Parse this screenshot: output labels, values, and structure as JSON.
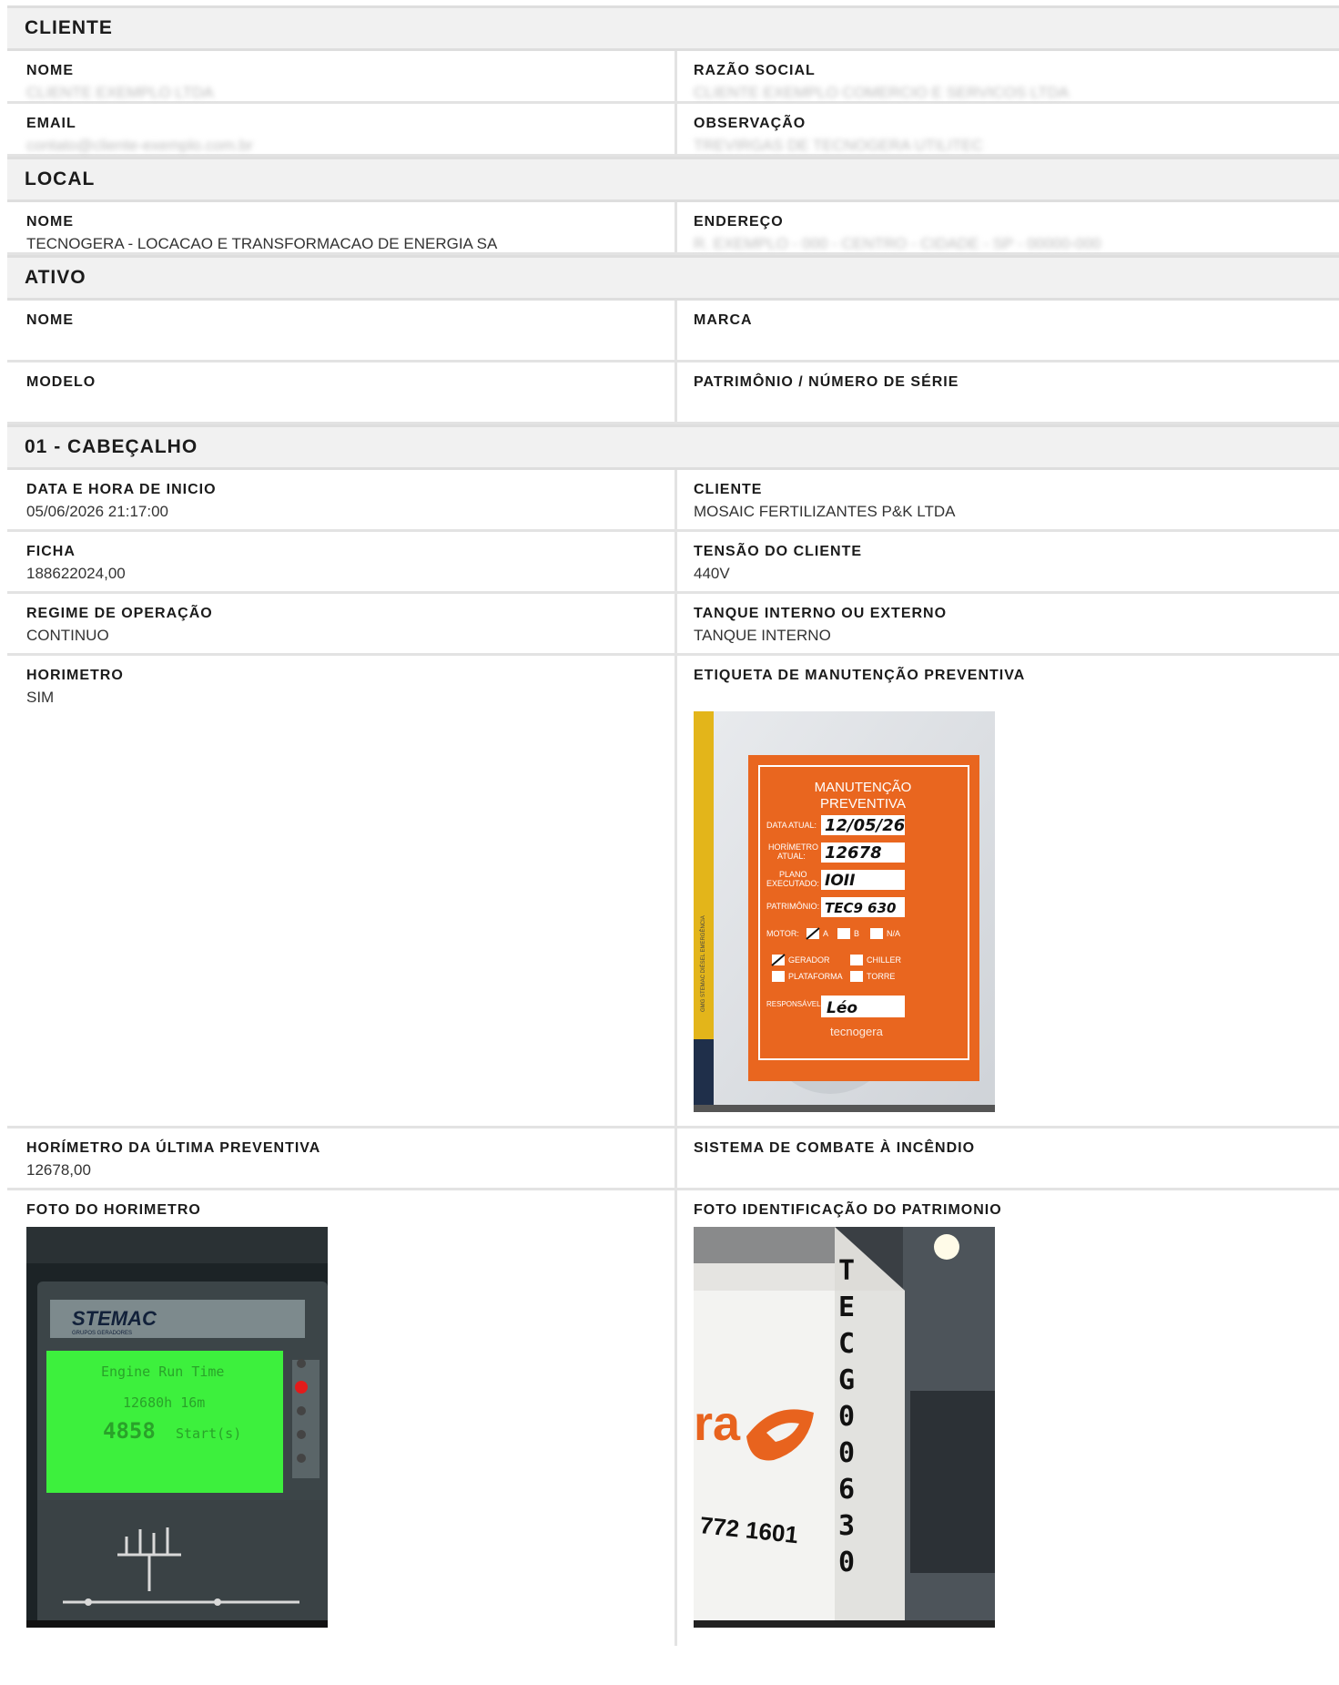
{
  "sections": {
    "cliente": {
      "title": "CLIENTE",
      "nome_label": "NOME",
      "nome_value": "CLIENTE EXEMPLO LTDA",
      "razao_label": "RAZÃO SOCIAL",
      "razao_value": "CLIENTE EXEMPLO COMERCIO E SERVICOS LTDA",
      "email_label": "EMAIL",
      "email_value": "contato@cliente-exemplo.com.br",
      "obs_label": "OBSERVAÇÃO",
      "obs_value": "TREVIRGAS DE TECNOGERA UTILITEC"
    },
    "local": {
      "title": "LOCAL",
      "nome_label": "NOME",
      "nome_value": "TECNOGERA - LOCACAO E TRANSFORMACAO DE ENERGIA SA",
      "endereco_label": "ENDEREÇO",
      "endereco_value": "R. EXEMPLO - 000 - CENTRO - CIDADE - SP - 00000-000"
    },
    "ativo": {
      "title": "ATIVO",
      "nome_label": "NOME",
      "marca_label": "MARCA",
      "modelo_label": "MODELO",
      "patrimonio_label": "PATRIMÔNIO / NÚMERO DE SÉRIE"
    },
    "cabecalho": {
      "title": "01 - CABEÇALHO",
      "inicio_label": "DATA E HORA DE INICIO",
      "inicio_value": "05/06/2026 21:17:00",
      "cliente_label": "CLIENTE",
      "cliente_value": "MOSAIC FERTILIZANTES P&K LTDA",
      "ficha_label": "FICHA",
      "ficha_value": "188622024,00",
      "tensao_label": "TENSÃO DO CLIENTE",
      "tensao_value": "440V",
      "regime_label": "REGIME DE OPERAÇÃO",
      "regime_value": "CONTINUO",
      "tanque_label": "TANQUE INTERNO OU EXTERNO",
      "tanque_value": "TANQUE INTERNO",
      "horimetro_label": "HORIMETRO",
      "horimetro_value": "SIM",
      "etiqueta_label": "ETIQUETA DE MANUTENÇÃO PREVENTIVA",
      "ultima_label": "HORÍMETRO DA ÚLTIMA PREVENTIVA",
      "ultima_value": "12678,00",
      "incendio_label": "SISTEMA DE COMBATE À INCÊNDIO",
      "foto_horimetro_label": "FOTO DO HORIMETRO",
      "foto_patrimonio_label": "FOTO IDENTIFICAÇÃO DO PATRIMONIO"
    }
  },
  "photos": {
    "etiqueta": {
      "title_line1": "MANUTENÇÃO",
      "title_line2": "PREVENTIVA",
      "data_atual_label": "DATA ATUAL:",
      "data_atual_value": "12/05/26",
      "horimetro_label_1": "HORÍMETRO",
      "horimetro_label_2": "ATUAL:",
      "horimetro_value": "12678",
      "plano_label_1": "PLANO",
      "plano_label_2": "EXECUTADO:",
      "plano_value": "IOII",
      "patrimonio_label": "PATRIMÔNIO:",
      "patrimonio_value": "TEC9 630",
      "motor_label": "MOTOR:",
      "opt_a": "A",
      "opt_b": "B",
      "opt_na": "N/A",
      "gerador": "GERADOR",
      "chiller": "CHILLER",
      "plataforma": "PLATAFORMA",
      "torre": "TORRE",
      "responsavel_label": "RESPONSÁVEL:",
      "responsavel_value": "Léo",
      "brand": "tecnogera",
      "side_text": "GMG STEMAC DIÉSEL EMERGÊNCIA"
    },
    "horimetro": {
      "brand": "STEMAC",
      "brand_sub": "GRUPOS GERADORES",
      "screen_title": "Engine Run Time",
      "screen_hours": "12680h 16m",
      "screen_starts": "4858",
      "screen_starts_unit": "Start(s)"
    },
    "patrimonio": {
      "vertical_code": [
        "T",
        "E",
        "C",
        "G",
        "0",
        "0",
        "6",
        "3",
        "0"
      ],
      "phone": "772 1601",
      "brand_fragment": "ra"
    }
  },
  "colors": {
    "section_bg": "#f1f1f1",
    "border": "#e3e3e3",
    "label_orange": "#e8631e",
    "lcd_green": "#3df03d"
  }
}
